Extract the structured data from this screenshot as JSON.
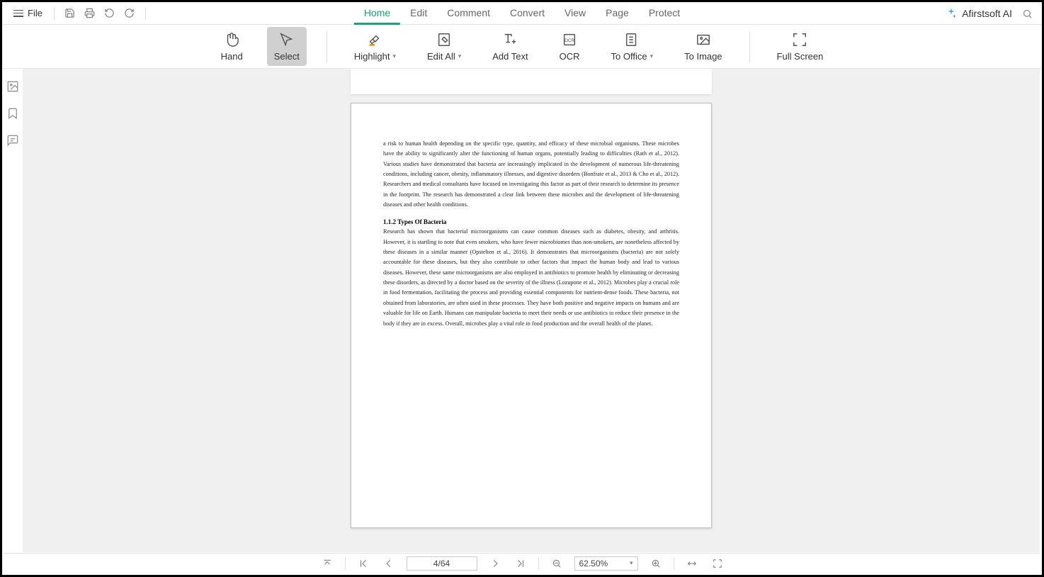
{
  "topbar": {
    "file_label": "File"
  },
  "menu": {
    "items": [
      "Home",
      "Edit",
      "Comment",
      "Convert",
      "View",
      "Page",
      "Protect"
    ],
    "active_index": 0
  },
  "ai": {
    "label": "Afirstsoft AI"
  },
  "toolbar": {
    "hand": "Hand",
    "select": "Select",
    "highlight": "Highlight",
    "edit_all": "Edit All",
    "add_text": "Add Text",
    "ocr": "OCR",
    "to_office": "To Office",
    "to_image": "To Image",
    "full_screen": "Full Screen"
  },
  "document": {
    "para1": "a risk to human health depending on the specific type, quantity, and efficacy of these microbial organisms. These microbes have the ability to significantly alter the functioning of human organs, potentially leading to difficulties (Rath et al., 2012). Various studies have demonstrated that bacteria are increasingly implicated in the development of numerous life-threatening conditions, including cancer, obesity, inflammatory illnesses, and digestive disorders (Bonfrate et al., 2013 & Cho et al., 2012). Researchers and medical consultants have focused on investigating this factor as part of their research to determine its presence in the footprint. The research has demonstrated a clear link between these microbes and the development of life-threatening diseases and other health conditions.",
    "heading": "1.1.2 Types Of Bacteria",
    "para2": "Research has shown that bacterial microorganisms can cause common diseases such as diabetes, obesity, and arthritis. However, it is startling to note that even smokers, who have fewer microbiomes than non-smokers, are nonetheless affected by these diseases in a similar manner (Opstelten et al., 2016). It demonstrates that microorganisms (bacteria) are not solely accountable for these diseases, but they also contribute to other factors that impact the human body and lead to various diseases. However, these same microorganisms are also employed in antibiotics to promote health by eliminating or decreasing these disorders, as directed by a doctor based on the severity of the illness (Lozupone et al., 2012). Microbes play a crucial role in food fermentation, facilitating the process and providing essential components for nutrient-dense foods. These bacteria, not obtained from laboratories, are often used in these processes. They have both positive and negative impacts on humans and are valuable for life on Earth. Humans can manipulate bacteria to meet their needs or use antibiotics to reduce their presence in the body if they are in excess. Overall, microbes play a vital role in food production and the overall health of the planet."
  },
  "bottombar": {
    "page_indicator": "4/64",
    "zoom_level": "62.50%"
  }
}
